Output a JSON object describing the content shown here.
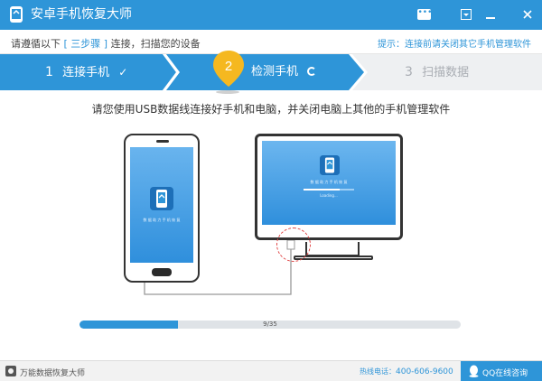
{
  "window": {
    "title": "安卓手机恢复大师"
  },
  "instruction": {
    "prefix": "请遵循以下",
    "highlight": "[ 三步骤 ]",
    "suffix": "连接，扫描您的设备",
    "tip": "提示：连接前请关闭其它手机管理软件"
  },
  "steps": [
    {
      "number": "1",
      "label": "连接手机",
      "state": "done"
    },
    {
      "number": "2",
      "label": "检测手机",
      "state": "active"
    },
    {
      "number": "3",
      "label": "扫描数据",
      "state": "pending"
    }
  ],
  "main": {
    "headline": "请您使用USB数据线连接好手机和电脑，并关闭电脑上其他的手机管理软件",
    "phone_app_text": "数 据 助 力 手 机 恢 复",
    "monitor_app_text": "数 据 助 力 手 机 恢 复",
    "monitor_loading": "Loading..."
  },
  "progress": {
    "current": 9,
    "total": 35,
    "text": "9/35"
  },
  "footer": {
    "brand": "万能数据恢复大师",
    "hotline_label": "热线电话：",
    "hotline_number": "400-606-9600",
    "qq_label": "QQ在线咨询"
  },
  "colors": {
    "primary": "#2e95d8",
    "step_pending": "#eef0f2",
    "badge": "#f5b820",
    "usb_ring": "#e04040"
  }
}
